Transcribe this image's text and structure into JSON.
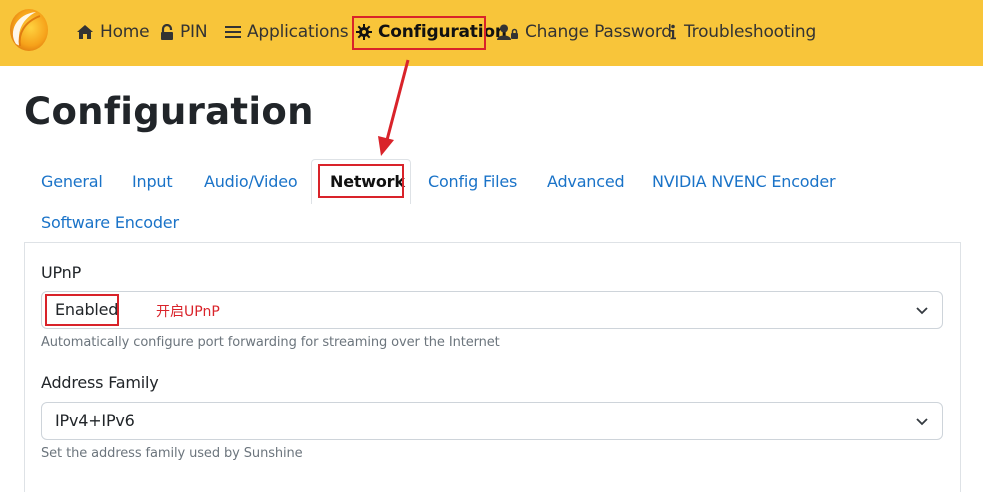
{
  "navbar": {
    "items": [
      {
        "label": "Home",
        "icon": "home-icon"
      },
      {
        "label": "PIN",
        "icon": "lock-icon"
      },
      {
        "label": "Applications",
        "icon": "list-icon"
      },
      {
        "label": "Configuration",
        "icon": "gear-icon"
      },
      {
        "label": "Change Password",
        "icon": "user-lock-icon"
      },
      {
        "label": "Troubleshooting",
        "icon": "info-icon"
      }
    ],
    "active": "Configuration",
    "background_color": "#f8c53a"
  },
  "page": {
    "title": "Configuration"
  },
  "tabs": {
    "items": [
      "General",
      "Input",
      "Audio/Video",
      "Network",
      "Config Files",
      "Advanced",
      "NVIDIA NVENC Encoder",
      "Software Encoder"
    ],
    "active": "Network",
    "link_color": "#1a73c8"
  },
  "settings": {
    "upnp": {
      "label": "UPnP",
      "value": "Enabled",
      "help": "Automatically configure port forwarding for streaming over the Internet"
    },
    "address_family": {
      "label": "Address Family",
      "value": "IPv4+IPv6",
      "help": "Set the address family used by Sunshine"
    }
  },
  "annotations": {
    "upnp_note": "开启UPnP",
    "highlight_color": "#d9232a"
  }
}
